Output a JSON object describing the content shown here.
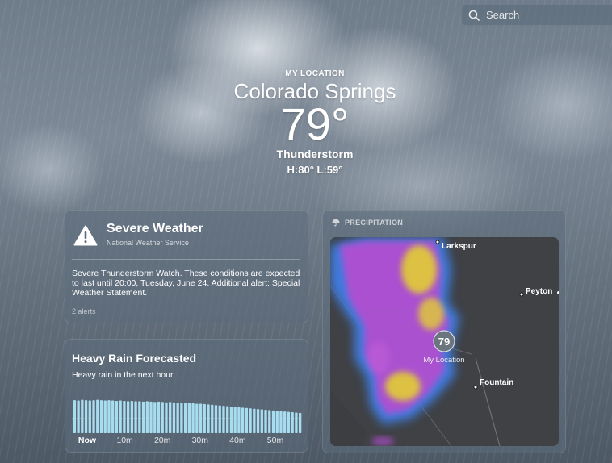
{
  "search": {
    "placeholder": "Search",
    "icon": "magnifying-glass"
  },
  "hero": {
    "location_label": "MY LOCATION",
    "city": "Colorado Springs",
    "temperature": "79°",
    "condition": "Thunderstorm",
    "high_low": "H:80°  L:59°"
  },
  "severe_card": {
    "icon": "warning-triangle",
    "title": "Severe Weather",
    "source": "National Weather Service",
    "description": "Severe Thunderstorm Watch. These conditions are expected to last until 20:00, Tuesday, June 24. Additional alert: Special Weather Statement.",
    "alerts_count": "2 alerts"
  },
  "rain_card": {
    "title": "Heavy Rain Forecasted",
    "subtitle": "Heavy rain in the next hour.",
    "time_labels": [
      "Now",
      "10m",
      "20m",
      "30m",
      "40m",
      "50m"
    ],
    "intensity": [
      0.93,
      0.92,
      0.94,
      0.93,
      0.92,
      0.93,
      0.94,
      0.93,
      0.92,
      0.93,
      0.92,
      0.91,
      0.92,
      0.91,
      0.9,
      0.91,
      0.9,
      0.9,
      0.89,
      0.9,
      0.89,
      0.88,
      0.89,
      0.88,
      0.87,
      0.88,
      0.87,
      0.86,
      0.86,
      0.85,
      0.85,
      0.84,
      0.83,
      0.83,
      0.82,
      0.81,
      0.8,
      0.79,
      0.78,
      0.77,
      0.76,
      0.75,
      0.74,
      0.73,
      0.72,
      0.71,
      0.7,
      0.69,
      0.68,
      0.67,
      0.66,
      0.65,
      0.64,
      0.63,
      0.62,
      0.61,
      0.6,
      0.59,
      0.58,
      0.57
    ],
    "bar_color": "#a8ddf0"
  },
  "precipitation_card": {
    "title": "PRECIPITATION",
    "icon": "umbrella",
    "map": {
      "places": [
        "Larkspur",
        "Peyton",
        "Fountain"
      ],
      "my_location_label": "My Location",
      "my_location_temp": "79"
    }
  },
  "colors": {
    "card_background": "rgba(92,108,124,0.55)",
    "map_background": "#3f4145",
    "radar_magenta": "#b04fd0",
    "radar_yellow": "#e0c83a",
    "radar_blue": "#3f80e8"
  }
}
